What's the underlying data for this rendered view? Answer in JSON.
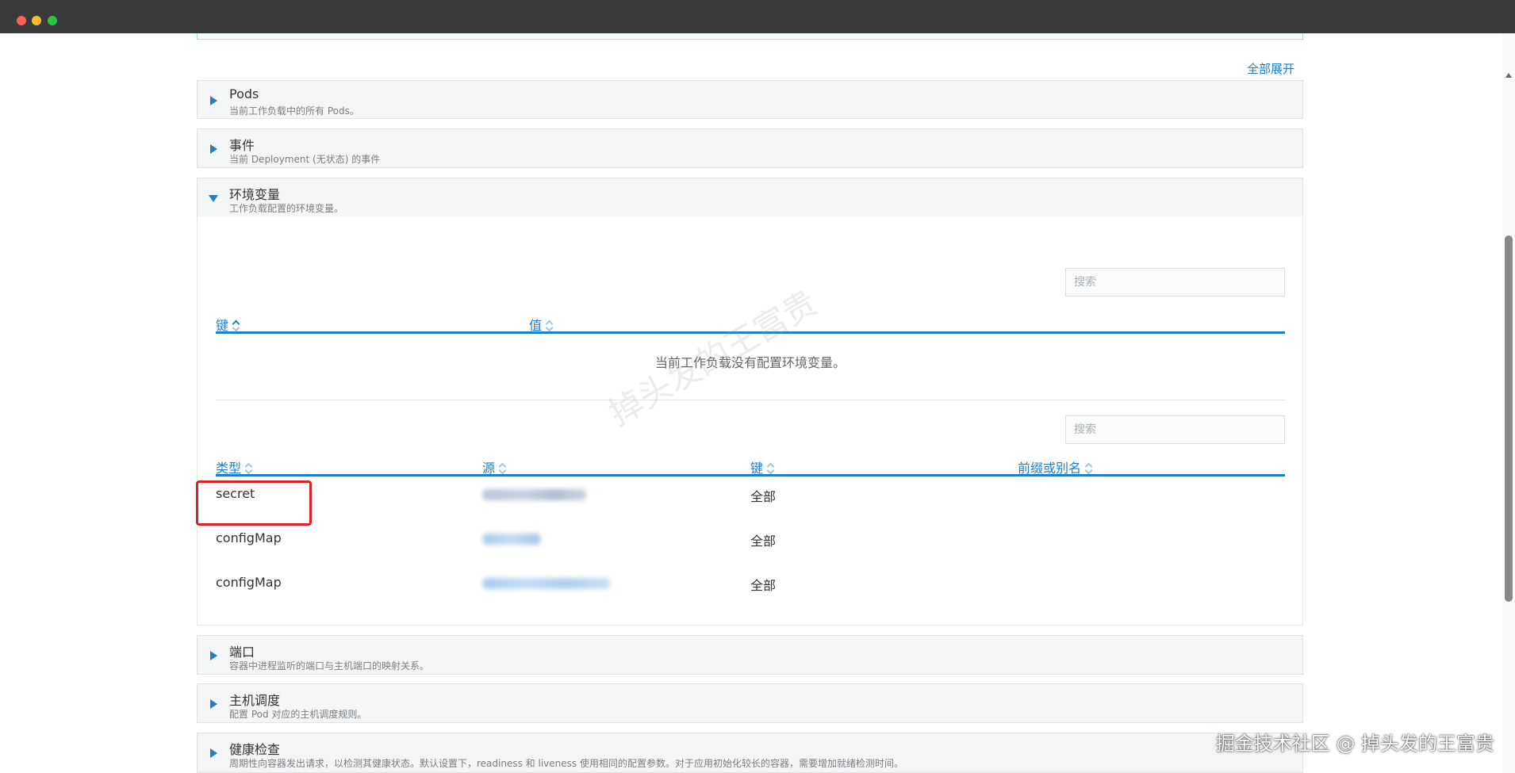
{
  "window": {
    "controls": [
      "close",
      "minimize",
      "maximize"
    ]
  },
  "expand_all": "全部展开",
  "sections": {
    "pods": {
      "title": "Pods",
      "subtitle": "当前工作负载中的所有 Pods。",
      "expanded": false
    },
    "events": {
      "title": "事件",
      "subtitle": "当前 Deployment (无状态) 的事件",
      "expanded": false
    },
    "env": {
      "title": "环境变量",
      "subtitle": "工作负载配置的环境变量。",
      "expanded": true
    },
    "ports": {
      "title": "端口",
      "subtitle": "容器中进程监听的端口与主机端口的映射关系。",
      "expanded": false
    },
    "scheduling": {
      "title": "主机调度",
      "subtitle": "配置 Pod 对应的主机调度规则。",
      "expanded": false
    },
    "health": {
      "title": "健康检查",
      "subtitle": "周期性向容器发出请求，以检测其健康状态。默认设置下，readiness 和 liveness 使用相同的配置参数。对于应用初始化较长的容器，需要增加就绪检测时间。",
      "expanded": false
    }
  },
  "env_table": {
    "search_placeholder": "搜索",
    "columns": [
      "键",
      "值"
    ],
    "empty_message": "当前工作负载没有配置环境变量。"
  },
  "env_from_table": {
    "search_placeholder": "搜索",
    "columns": [
      "类型",
      "源",
      "键",
      "前缀或别名"
    ],
    "rows": [
      {
        "type": "secret",
        "source_redacted": true,
        "key": "全部",
        "prefix": ""
      },
      {
        "type": "configMap",
        "source_redacted": true,
        "key": "全部",
        "prefix": ""
      },
      {
        "type": "configMap",
        "source_redacted": true,
        "key": "全部",
        "prefix": ""
      }
    ]
  },
  "watermark": "掉头发的王富贵",
  "credit": "掘金技术社区 @ 掉头发的王富贵",
  "colors": {
    "accent": "#1f80c8",
    "highlight": "#d8232a",
    "panel_bg": "#f4f5f5",
    "titlebar": "#3a3a3a"
  }
}
